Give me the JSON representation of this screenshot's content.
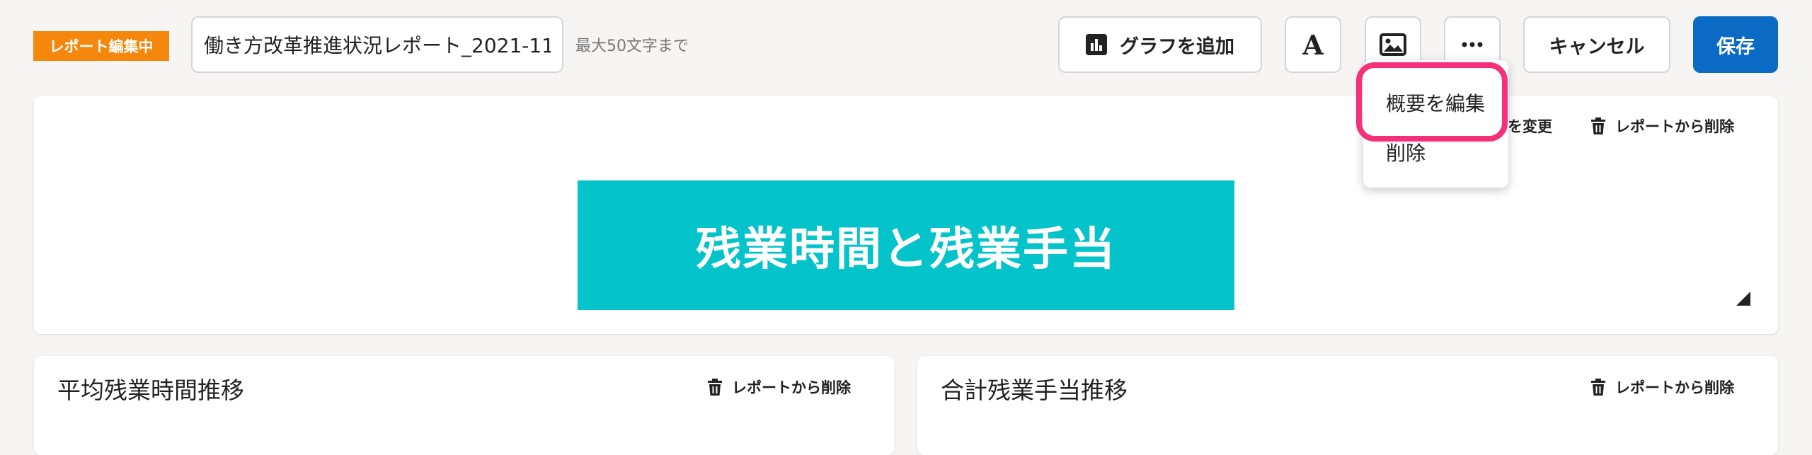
{
  "header": {
    "badge": "レポート編集中",
    "title_value": "働き方改革推進状況レポート_2021-11-",
    "title_hint": "最大50文字まで",
    "add_graph_label": "グラフを追加",
    "cancel_label": "キャンセル",
    "save_label": "保存"
  },
  "dropdown": {
    "items": [
      "概要を編集",
      "削除"
    ]
  },
  "banner_card": {
    "change_label": "を変更",
    "delete_label": "レポートから削除",
    "banner_text": "残業時間と残業手当"
  },
  "cards": [
    {
      "title": "平均残業時間推移",
      "delete_label": "レポートから削除"
    },
    {
      "title": "合計残業手当推移",
      "delete_label": "レポートから削除"
    }
  ],
  "colors": {
    "badge": "#f5870c",
    "save": "#0b6bc4",
    "banner": "#05c3cb",
    "highlight": "#f5307a"
  }
}
